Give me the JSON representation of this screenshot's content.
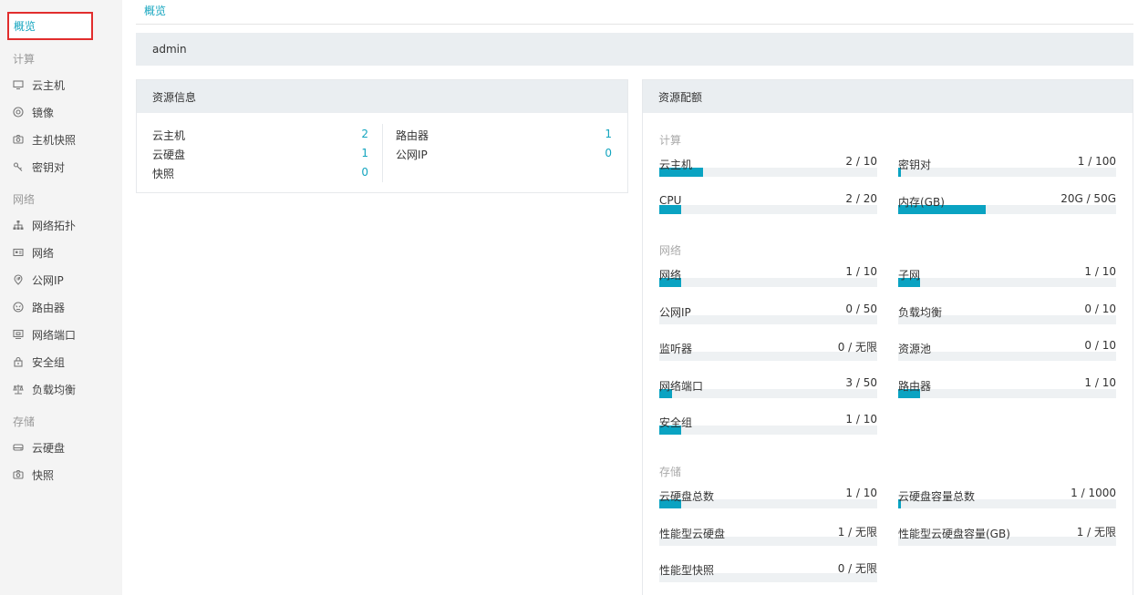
{
  "sidebar": {
    "active": {
      "label": "概览",
      "icon": "dashboard-icon"
    },
    "groups": [
      {
        "title": "计算",
        "items": [
          {
            "label": "云主机",
            "icon": "monitor-icon"
          },
          {
            "label": "镜像",
            "icon": "disc-icon"
          },
          {
            "label": "主机快照",
            "icon": "camera-icon"
          },
          {
            "label": "密钥对",
            "icon": "key-icon"
          }
        ]
      },
      {
        "title": "网络",
        "items": [
          {
            "label": "网络拓扑",
            "icon": "topology-icon"
          },
          {
            "label": "网络",
            "icon": "network-card-icon"
          },
          {
            "label": "公网IP",
            "icon": "ip-pin-icon"
          },
          {
            "label": "路由器",
            "icon": "router-icon"
          },
          {
            "label": "网络端口",
            "icon": "port-icon"
          },
          {
            "label": "安全组",
            "icon": "lock-icon"
          },
          {
            "label": "负载均衡",
            "icon": "balance-icon"
          }
        ]
      },
      {
        "title": "存储",
        "items": [
          {
            "label": "云硬盘",
            "icon": "disk-icon"
          },
          {
            "label": "快照",
            "icon": "camera-icon"
          }
        ]
      }
    ]
  },
  "breadcrumb": "概览",
  "user": "admin",
  "resource_info": {
    "title": "资源信息",
    "left": [
      {
        "label": "云主机",
        "value": "2"
      },
      {
        "label": "云硬盘",
        "value": "1"
      },
      {
        "label": "快照",
        "value": "0"
      }
    ],
    "right": [
      {
        "label": "路由器",
        "value": "1"
      },
      {
        "label": "公网IP",
        "value": "0"
      }
    ]
  },
  "quota": {
    "title": "资源配额",
    "groups": [
      {
        "title": "计算",
        "items": [
          {
            "label": "云主机",
            "value": "2 / 10",
            "fraction": 0.2
          },
          {
            "label": "密钥对",
            "value": "1 / 100",
            "fraction": 0.01
          },
          {
            "label": "CPU",
            "value": "2 / 20",
            "fraction": 0.1
          },
          {
            "label": "内存(GB)",
            "value": "20G / 50G",
            "fraction": 0.4
          }
        ]
      },
      {
        "title": "网络",
        "items": [
          {
            "label": "网络",
            "value": "1 / 10",
            "fraction": 0.1
          },
          {
            "label": "子网",
            "value": "1 / 10",
            "fraction": 0.1
          },
          {
            "label": "公网IP",
            "value": "0 / 50",
            "fraction": 0
          },
          {
            "label": "负载均衡",
            "value": "0 / 10",
            "fraction": 0
          },
          {
            "label": "监听器",
            "value": "0 / 无限",
            "fraction": 0
          },
          {
            "label": "资源池",
            "value": "0 / 10",
            "fraction": 0
          },
          {
            "label": "网络端口",
            "value": "3 / 50",
            "fraction": 0.06
          },
          {
            "label": "路由器",
            "value": "1 / 10",
            "fraction": 0.1
          },
          {
            "label": "安全组",
            "value": "1 / 10",
            "fraction": 0.1
          }
        ]
      },
      {
        "title": "存储",
        "items": [
          {
            "label": "云硬盘总数",
            "value": "1 / 10",
            "fraction": 0.1
          },
          {
            "label": "云硬盘容量总数",
            "value": "1 / 1000",
            "fraction": 0.001
          },
          {
            "label": "性能型云硬盘",
            "value": "1 / 无限",
            "fraction": 0
          },
          {
            "label": "性能型云硬盘容量(GB)",
            "value": "1 / 无限",
            "fraction": 0
          },
          {
            "label": "性能型快照",
            "value": "0 / 无限",
            "fraction": 0
          }
        ]
      }
    ]
  },
  "colors": {
    "accent": "#14a5bf",
    "bar_fill": "#0aa3c2",
    "bar_track": "#eef1f3",
    "highlight_border": "#e12d2d"
  }
}
